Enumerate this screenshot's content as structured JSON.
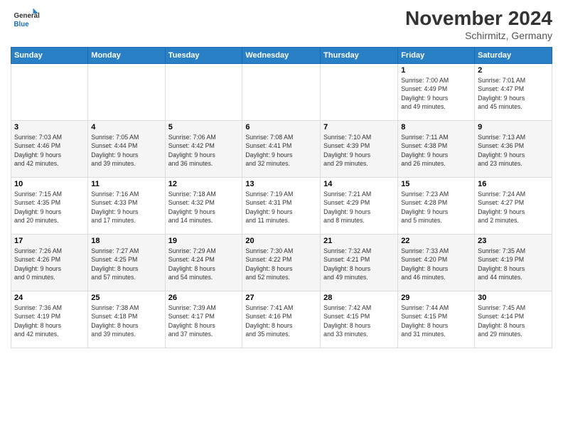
{
  "header": {
    "logo_line1": "General",
    "logo_line2": "Blue",
    "month_title": "November 2024",
    "location": "Schirmitz, Germany"
  },
  "calendar": {
    "headers": [
      "Sunday",
      "Monday",
      "Tuesday",
      "Wednesday",
      "Thursday",
      "Friday",
      "Saturday"
    ],
    "weeks": [
      [
        {
          "day": "",
          "info": ""
        },
        {
          "day": "",
          "info": ""
        },
        {
          "day": "",
          "info": ""
        },
        {
          "day": "",
          "info": ""
        },
        {
          "day": "",
          "info": ""
        },
        {
          "day": "1",
          "info": "Sunrise: 7:00 AM\nSunset: 4:49 PM\nDaylight: 9 hours\nand 49 minutes."
        },
        {
          "day": "2",
          "info": "Sunrise: 7:01 AM\nSunset: 4:47 PM\nDaylight: 9 hours\nand 45 minutes."
        }
      ],
      [
        {
          "day": "3",
          "info": "Sunrise: 7:03 AM\nSunset: 4:46 PM\nDaylight: 9 hours\nand 42 minutes."
        },
        {
          "day": "4",
          "info": "Sunrise: 7:05 AM\nSunset: 4:44 PM\nDaylight: 9 hours\nand 39 minutes."
        },
        {
          "day": "5",
          "info": "Sunrise: 7:06 AM\nSunset: 4:42 PM\nDaylight: 9 hours\nand 36 minutes."
        },
        {
          "day": "6",
          "info": "Sunrise: 7:08 AM\nSunset: 4:41 PM\nDaylight: 9 hours\nand 32 minutes."
        },
        {
          "day": "7",
          "info": "Sunrise: 7:10 AM\nSunset: 4:39 PM\nDaylight: 9 hours\nand 29 minutes."
        },
        {
          "day": "8",
          "info": "Sunrise: 7:11 AM\nSunset: 4:38 PM\nDaylight: 9 hours\nand 26 minutes."
        },
        {
          "day": "9",
          "info": "Sunrise: 7:13 AM\nSunset: 4:36 PM\nDaylight: 9 hours\nand 23 minutes."
        }
      ],
      [
        {
          "day": "10",
          "info": "Sunrise: 7:15 AM\nSunset: 4:35 PM\nDaylight: 9 hours\nand 20 minutes."
        },
        {
          "day": "11",
          "info": "Sunrise: 7:16 AM\nSunset: 4:33 PM\nDaylight: 9 hours\nand 17 minutes."
        },
        {
          "day": "12",
          "info": "Sunrise: 7:18 AM\nSunset: 4:32 PM\nDaylight: 9 hours\nand 14 minutes."
        },
        {
          "day": "13",
          "info": "Sunrise: 7:19 AM\nSunset: 4:31 PM\nDaylight: 9 hours\nand 11 minutes."
        },
        {
          "day": "14",
          "info": "Sunrise: 7:21 AM\nSunset: 4:29 PM\nDaylight: 9 hours\nand 8 minutes."
        },
        {
          "day": "15",
          "info": "Sunrise: 7:23 AM\nSunset: 4:28 PM\nDaylight: 9 hours\nand 5 minutes."
        },
        {
          "day": "16",
          "info": "Sunrise: 7:24 AM\nSunset: 4:27 PM\nDaylight: 9 hours\nand 2 minutes."
        }
      ],
      [
        {
          "day": "17",
          "info": "Sunrise: 7:26 AM\nSunset: 4:26 PM\nDaylight: 9 hours\nand 0 minutes."
        },
        {
          "day": "18",
          "info": "Sunrise: 7:27 AM\nSunset: 4:25 PM\nDaylight: 8 hours\nand 57 minutes."
        },
        {
          "day": "19",
          "info": "Sunrise: 7:29 AM\nSunset: 4:24 PM\nDaylight: 8 hours\nand 54 minutes."
        },
        {
          "day": "20",
          "info": "Sunrise: 7:30 AM\nSunset: 4:22 PM\nDaylight: 8 hours\nand 52 minutes."
        },
        {
          "day": "21",
          "info": "Sunrise: 7:32 AM\nSunset: 4:21 PM\nDaylight: 8 hours\nand 49 minutes."
        },
        {
          "day": "22",
          "info": "Sunrise: 7:33 AM\nSunset: 4:20 PM\nDaylight: 8 hours\nand 46 minutes."
        },
        {
          "day": "23",
          "info": "Sunrise: 7:35 AM\nSunset: 4:19 PM\nDaylight: 8 hours\nand 44 minutes."
        }
      ],
      [
        {
          "day": "24",
          "info": "Sunrise: 7:36 AM\nSunset: 4:19 PM\nDaylight: 8 hours\nand 42 minutes."
        },
        {
          "day": "25",
          "info": "Sunrise: 7:38 AM\nSunset: 4:18 PM\nDaylight: 8 hours\nand 39 minutes."
        },
        {
          "day": "26",
          "info": "Sunrise: 7:39 AM\nSunset: 4:17 PM\nDaylight: 8 hours\nand 37 minutes."
        },
        {
          "day": "27",
          "info": "Sunrise: 7:41 AM\nSunset: 4:16 PM\nDaylight: 8 hours\nand 35 minutes."
        },
        {
          "day": "28",
          "info": "Sunrise: 7:42 AM\nSunset: 4:15 PM\nDaylight: 8 hours\nand 33 minutes."
        },
        {
          "day": "29",
          "info": "Sunrise: 7:44 AM\nSunset: 4:15 PM\nDaylight: 8 hours\nand 31 minutes."
        },
        {
          "day": "30",
          "info": "Sunrise: 7:45 AM\nSunset: 4:14 PM\nDaylight: 8 hours\nand 29 minutes."
        }
      ]
    ]
  }
}
